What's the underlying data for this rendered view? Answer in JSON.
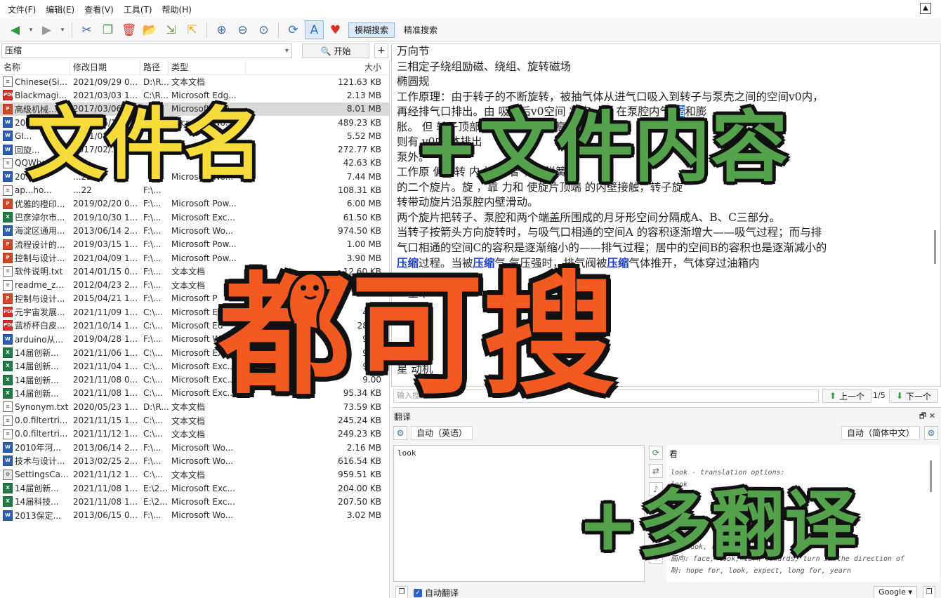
{
  "menu": [
    "文件(F)",
    "编辑(E)",
    "查看(V)",
    "工具(T)",
    "帮助(H)"
  ],
  "toolbar": {
    "mode_fuzzy": "模糊搜索",
    "mode_exact": "精准搜索",
    "icons": [
      "back-arrow",
      "forward-arrow",
      "cut",
      "copy",
      "delete",
      "open-folder",
      "export",
      "import",
      "zoom-in",
      "zoom-out",
      "zoom-reset",
      "refresh",
      "translate",
      "heart-donate"
    ]
  },
  "search": {
    "value": "压缩",
    "start_label": "开始",
    "add_label": "+"
  },
  "file_list": {
    "headers": {
      "name": "名称",
      "date": "修改日期",
      "path": "路径",
      "type": "类型",
      "size": "大小"
    },
    "rows": [
      {
        "icon": "txt",
        "name": "Chinese(Si...",
        "date": "2021/09/29  0...",
        "path": "D:\\R...",
        "type": "文本文档",
        "size": "121.63 KB"
      },
      {
        "icon": "pdf",
        "name": "Blackmagi...",
        "date": "2021/03/03  1...",
        "path": "C:\\R...",
        "type": "Microsoft Edg...",
        "size": "2.13 MB"
      },
      {
        "icon": "ppt",
        "name": "高级机械...",
        "date": "2017/03/06  1...",
        "path": "F:\\...",
        "type": "Microsoft Pow...",
        "size": "8.01 MB",
        "selected": true
      },
      {
        "icon": "word",
        "name": "2011年...",
        "date": "2021/06/18",
        "path": "",
        "type": "Microsoft Wo...",
        "size": "489.23 KB"
      },
      {
        "icon": "word",
        "name": "GI...",
        "date": "2021/03/06",
        "path": "",
        "type": "",
        "size": "5.52 MB"
      },
      {
        "icon": "word",
        "name": "回旋...",
        "date": "2017/02/...",
        "path": "",
        "type": "",
        "size": "272.77 KB"
      },
      {
        "icon": "txt",
        "name": "QQWha...",
        "date": "",
        "path": "",
        "type": "",
        "size": "42.63 KB"
      },
      {
        "icon": "word",
        "name": "20...",
        "date": "...22",
        "path": "",
        "type": "Microsoft Wo...",
        "size": "7.44 MB"
      },
      {
        "icon": "txt",
        "name": "ap...ho...",
        "date": "...22",
        "path": "F:\\...",
        "type": "",
        "size": "108.31 KB"
      },
      {
        "icon": "ppt",
        "name": "优雅的橙印...",
        "date": "2019/02/20  0...",
        "path": "F:\\...",
        "type": "Microsoft Pow...",
        "size": "6.00 MB"
      },
      {
        "icon": "excel",
        "name": "巴彦淖尔市...",
        "date": "2019/10/30  1...",
        "path": "F:\\...",
        "type": "Microsoft Exc...",
        "size": "61.50 KB"
      },
      {
        "icon": "word",
        "name": "海淀区通用...",
        "date": "2013/06/14  2...",
        "path": "F:\\...",
        "type": "Microsoft Wo...",
        "size": "974.50 KB"
      },
      {
        "icon": "ppt",
        "name": "流程设计的...",
        "date": "2019/03/15  1...",
        "path": "F:\\...",
        "type": "Microsoft Pow...",
        "size": "1.00 MB"
      },
      {
        "icon": "ppt",
        "name": "控制与设计...",
        "date": "2021/04/09  1...",
        "path": "F:\\...",
        "type": "Microsoft Pow...",
        "size": "3.90 MB"
      },
      {
        "icon": "txt",
        "name": "软件说明.txt",
        "date": "2014/01/15  0...",
        "path": "F:\\...",
        "type": "文本文档",
        "size": "12.60 KB"
      },
      {
        "icon": "txt",
        "name": "readme_z...",
        "date": "2012/04/23  2...",
        "path": "F:\\...",
        "type": "文本文档",
        "size": ""
      },
      {
        "icon": "ppt",
        "name": "控制与设计...",
        "date": "2015/04/21  1...",
        "path": "F:\\...",
        "type": "Microsoft P",
        "size": ""
      },
      {
        "icon": "pdf",
        "name": "元宇宙发展...",
        "date": "2021/11/09  1...",
        "path": "C:\\...",
        "type": "Microsoft E",
        "size": "4.38"
      },
      {
        "icon": "pdf",
        "name": "蓝桥杯白皮...",
        "date": "2021/10/14  1...",
        "path": "C:\\...",
        "type": "Microsoft Ed",
        "size": "28.14"
      },
      {
        "icon": "word",
        "name": "arduino从...",
        "date": "2019/04/28  1...",
        "path": "F:\\...",
        "type": "Microsoft W",
        "size": "9.08"
      },
      {
        "icon": "excel",
        "name": "14届创新...",
        "date": "2021/11/06  1...",
        "path": "C:\\...",
        "type": "Microsoft Exc",
        "size": "9.00"
      },
      {
        "icon": "excel",
        "name": "14届创新...",
        "date": "2021/11/04  1...",
        "path": "C:\\...",
        "type": "Microsoft Exc...",
        "size": "9.00"
      },
      {
        "icon": "excel",
        "name": "14届创新...",
        "date": "2021/11/08  0...",
        "path": "C:\\...",
        "type": "Microsoft Exc...",
        "size": "9.00"
      },
      {
        "icon": "excel",
        "name": "14届创新...",
        "date": "2021/11/08  1...",
        "path": "C:\\...",
        "type": "Microsoft Exc...",
        "size": "95.34 KB"
      },
      {
        "icon": "txt",
        "name": "Synonym.txt",
        "date": "2020/05/23  1...",
        "path": "D:\\R...",
        "type": "文本文档",
        "size": "73.59 KB"
      },
      {
        "icon": "txt",
        "name": "0.0.filtertri...",
        "date": "2021/11/15  1...",
        "path": "C:\\...",
        "type": "文本文档",
        "size": "245.24 KB"
      },
      {
        "icon": "txt",
        "name": "0.0.filtertri...",
        "date": "2021/11/12  1...",
        "path": "C:\\...",
        "type": "文本文档",
        "size": "249.23 KB"
      },
      {
        "icon": "word",
        "name": "2010年河...",
        "date": "2013/06/14  2...",
        "path": "F:\\...",
        "type": "Microsoft Wo...",
        "size": "2.16 MB"
      },
      {
        "icon": "word",
        "name": "技术与设计...",
        "date": "2013/02/25  2...",
        "path": "F:\\...",
        "type": "Microsoft Wo...",
        "size": "616.54 KB"
      },
      {
        "icon": "set",
        "name": "SettingsCa...",
        "date": "2021/11/12  1...",
        "path": "C:\\...",
        "type": "文本文档",
        "size": "959.51 KB"
      },
      {
        "icon": "excel",
        "name": "14届创新...",
        "date": "2021/11/08  1...",
        "path": "E:\\2...",
        "type": "Microsoft Exc...",
        "size": "204.00 KB"
      },
      {
        "icon": "excel",
        "name": "14届科技...",
        "date": "2021/11/08  1...",
        "path": "E:\\2...",
        "type": "Microsoft Exc...",
        "size": "207.50 KB"
      },
      {
        "icon": "word",
        "name": "2013保定...",
        "date": "2013/06/15  0...",
        "path": "F:\\...",
        "type": "Microsoft Wo...",
        "size": "3.02 MB"
      }
    ]
  },
  "content": {
    "lines": [
      [
        {
          "t": "万向节"
        }
      ],
      [
        {
          "t": "三相定子绕组励磁、绕组、旋转磁场"
        }
      ],
      [
        {
          "t": "椭圆规"
        }
      ],
      [
        {
          "t": "工作原理：由于转子的不断旋转，被抽气体从进气口吸入到转子与泵壳之间的空间v0内，"
        }
      ],
      [
        {
          "t": "再经排气口排出。由  吸气后v0空间  状态，所  在泵腔内气  "
        },
        {
          "t": "缩",
          "c": "hl-sel"
        },
        {
          "t": "和膨"
        }
      ],
      [
        {
          "t": "胀。  但  转子顶部  边缘  排  压强较高，"
        }
      ],
      [
        {
          "t": "则有  v0中  体排出"
        }
      ],
      [
        {
          "t": "泵外。"
        }
      ],
      [
        {
          "t": "工作原  偏心转  内  相  二者  有带弹簧"
        }
      ],
      [
        {
          "t": "的二个旋片。旋  ，靠  力和  使旋片顶端  的内壁接触，转子旋"
        }
      ],
      [
        {
          "t": "转带动旋片沿泵腔内壁滑动。"
        }
      ],
      [
        {
          "t": "        两个旋片把转子、泵腔和两个端盖所围成的月牙形空间分隔成A、B、C三部分。"
        }
      ],
      [
        {
          "t": "当转子按箭头方向旋转时，与吸气口相通的空间A 的容积逐渐增大——吸气过程；而与排"
        }
      ],
      [
        {
          "t": "气口相通的空间C的容积是逐渐缩小的——排气过程；居中的空间B的容积也是逐渐减小的"
        }
      ],
      [
        {
          "t": "  "
        },
        {
          "t": "压缩",
          "c": "hl"
        },
        {
          "t": "过程。当被"
        },
        {
          "t": "压缩",
          "c": "hl"
        },
        {
          "t": "气  气压强时，排气阀被"
        },
        {
          "t": "压缩",
          "c": "hl"
        },
        {
          "t": "气体推开，气体穿过油箱内"
        }
      ],
      [
        {
          "t": "  连续抽气的目的。"
        }
      ],
      [
        {
          "t": "  一全本"
        }
      ],
      [
        {
          "t": "  原理"
        }
      ],
      [
        {
          "t": ""
        }
      ],
      [
        {
          "t": ""
        }
      ],
      [
        {
          "t": "  缸排"
        }
      ],
      [
        {
          "t": "  星  动机"
        }
      ]
    ]
  },
  "content_search": {
    "placeholder": "输入搜索",
    "prev_label": "上一个",
    "count": "1/5",
    "next_label": "下一个"
  },
  "translate": {
    "title": "翻译",
    "source_lang": "自动（英语）",
    "target_lang": "自动（简体中文）",
    "source_text": "look",
    "result_main": "看",
    "result_lines": [
      "look - translation options:",
      "      look",
      "      care,",
      "      look,",
      "      look, so",
      "      care, lo",
      "  看: look, read",
      "  面向: face, look, turn towards, turn in the direction of",
      "  盼: hope for, look, expect, long for, yearn"
    ],
    "auto_translate_label": "自动翻译",
    "engine": "Google"
  },
  "overlay": {
    "caption_1": "文件名",
    "caption_2": "+文件内容",
    "caption_3": "都可搜",
    "caption_4": "+多翻译"
  }
}
